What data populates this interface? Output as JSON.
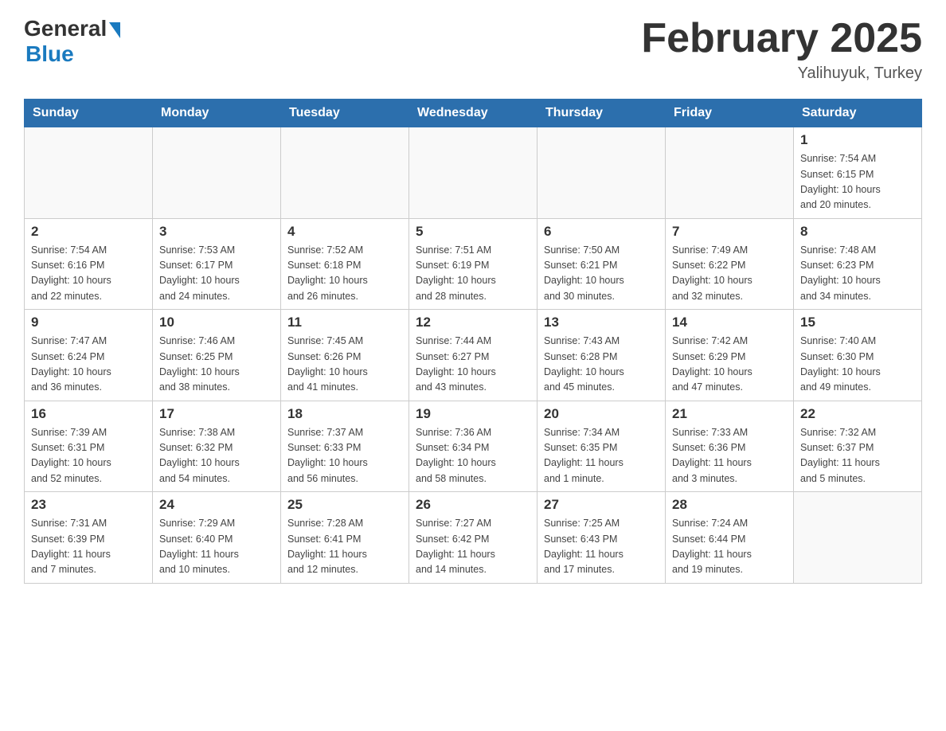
{
  "header": {
    "logo_general": "General",
    "logo_blue": "Blue",
    "month_title": "February 2025",
    "location": "Yalihuyuk, Turkey"
  },
  "days_of_week": [
    "Sunday",
    "Monday",
    "Tuesday",
    "Wednesday",
    "Thursday",
    "Friday",
    "Saturday"
  ],
  "weeks": [
    [
      {
        "day": "",
        "info": ""
      },
      {
        "day": "",
        "info": ""
      },
      {
        "day": "",
        "info": ""
      },
      {
        "day": "",
        "info": ""
      },
      {
        "day": "",
        "info": ""
      },
      {
        "day": "",
        "info": ""
      },
      {
        "day": "1",
        "info": "Sunrise: 7:54 AM\nSunset: 6:15 PM\nDaylight: 10 hours\nand 20 minutes."
      }
    ],
    [
      {
        "day": "2",
        "info": "Sunrise: 7:54 AM\nSunset: 6:16 PM\nDaylight: 10 hours\nand 22 minutes."
      },
      {
        "day": "3",
        "info": "Sunrise: 7:53 AM\nSunset: 6:17 PM\nDaylight: 10 hours\nand 24 minutes."
      },
      {
        "day": "4",
        "info": "Sunrise: 7:52 AM\nSunset: 6:18 PM\nDaylight: 10 hours\nand 26 minutes."
      },
      {
        "day": "5",
        "info": "Sunrise: 7:51 AM\nSunset: 6:19 PM\nDaylight: 10 hours\nand 28 minutes."
      },
      {
        "day": "6",
        "info": "Sunrise: 7:50 AM\nSunset: 6:21 PM\nDaylight: 10 hours\nand 30 minutes."
      },
      {
        "day": "7",
        "info": "Sunrise: 7:49 AM\nSunset: 6:22 PM\nDaylight: 10 hours\nand 32 minutes."
      },
      {
        "day": "8",
        "info": "Sunrise: 7:48 AM\nSunset: 6:23 PM\nDaylight: 10 hours\nand 34 minutes."
      }
    ],
    [
      {
        "day": "9",
        "info": "Sunrise: 7:47 AM\nSunset: 6:24 PM\nDaylight: 10 hours\nand 36 minutes."
      },
      {
        "day": "10",
        "info": "Sunrise: 7:46 AM\nSunset: 6:25 PM\nDaylight: 10 hours\nand 38 minutes."
      },
      {
        "day": "11",
        "info": "Sunrise: 7:45 AM\nSunset: 6:26 PM\nDaylight: 10 hours\nand 41 minutes."
      },
      {
        "day": "12",
        "info": "Sunrise: 7:44 AM\nSunset: 6:27 PM\nDaylight: 10 hours\nand 43 minutes."
      },
      {
        "day": "13",
        "info": "Sunrise: 7:43 AM\nSunset: 6:28 PM\nDaylight: 10 hours\nand 45 minutes."
      },
      {
        "day": "14",
        "info": "Sunrise: 7:42 AM\nSunset: 6:29 PM\nDaylight: 10 hours\nand 47 minutes."
      },
      {
        "day": "15",
        "info": "Sunrise: 7:40 AM\nSunset: 6:30 PM\nDaylight: 10 hours\nand 49 minutes."
      }
    ],
    [
      {
        "day": "16",
        "info": "Sunrise: 7:39 AM\nSunset: 6:31 PM\nDaylight: 10 hours\nand 52 minutes."
      },
      {
        "day": "17",
        "info": "Sunrise: 7:38 AM\nSunset: 6:32 PM\nDaylight: 10 hours\nand 54 minutes."
      },
      {
        "day": "18",
        "info": "Sunrise: 7:37 AM\nSunset: 6:33 PM\nDaylight: 10 hours\nand 56 minutes."
      },
      {
        "day": "19",
        "info": "Sunrise: 7:36 AM\nSunset: 6:34 PM\nDaylight: 10 hours\nand 58 minutes."
      },
      {
        "day": "20",
        "info": "Sunrise: 7:34 AM\nSunset: 6:35 PM\nDaylight: 11 hours\nand 1 minute."
      },
      {
        "day": "21",
        "info": "Sunrise: 7:33 AM\nSunset: 6:36 PM\nDaylight: 11 hours\nand 3 minutes."
      },
      {
        "day": "22",
        "info": "Sunrise: 7:32 AM\nSunset: 6:37 PM\nDaylight: 11 hours\nand 5 minutes."
      }
    ],
    [
      {
        "day": "23",
        "info": "Sunrise: 7:31 AM\nSunset: 6:39 PM\nDaylight: 11 hours\nand 7 minutes."
      },
      {
        "day": "24",
        "info": "Sunrise: 7:29 AM\nSunset: 6:40 PM\nDaylight: 11 hours\nand 10 minutes."
      },
      {
        "day": "25",
        "info": "Sunrise: 7:28 AM\nSunset: 6:41 PM\nDaylight: 11 hours\nand 12 minutes."
      },
      {
        "day": "26",
        "info": "Sunrise: 7:27 AM\nSunset: 6:42 PM\nDaylight: 11 hours\nand 14 minutes."
      },
      {
        "day": "27",
        "info": "Sunrise: 7:25 AM\nSunset: 6:43 PM\nDaylight: 11 hours\nand 17 minutes."
      },
      {
        "day": "28",
        "info": "Sunrise: 7:24 AM\nSunset: 6:44 PM\nDaylight: 11 hours\nand 19 minutes."
      },
      {
        "day": "",
        "info": ""
      }
    ]
  ]
}
